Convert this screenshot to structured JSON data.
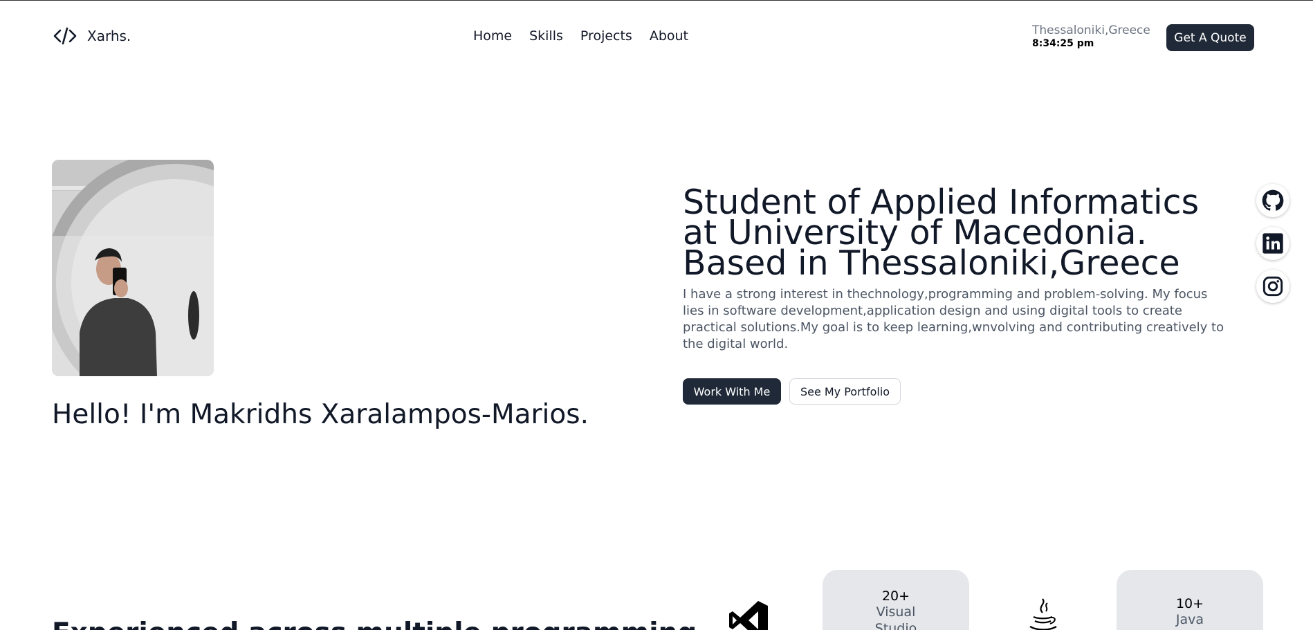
{
  "brand": {
    "name": "Xarhs.",
    "icon": "code-icon"
  },
  "nav": {
    "items": [
      "Home",
      "Skills",
      "Projects",
      "About"
    ]
  },
  "location": {
    "city": "Thessaloniki,Greece",
    "time": "8:34:25 pm"
  },
  "header": {
    "quote_label": "Get A Quote"
  },
  "hero": {
    "greeting": "Hello! I'm Makridhs Xaralampos-Marios.",
    "headline": "Student of Applied Informatics at University of Macedonia. Based in Thessaloniki,Greece",
    "description": "I have a strong interest in thechnology,programming and problem-solving. My focus lies in software development,application design and using digital tools to create practical solutions.My goal is to keep learning,wnvolving and contributing creatively to the digital world.",
    "primary_label": "Work With Me",
    "secondary_label": "See My Portfolio"
  },
  "social": [
    {
      "icon": "github-icon"
    },
    {
      "icon": "linkedin-icon"
    },
    {
      "icon": "instagram-icon"
    }
  ],
  "experience": {
    "title": "Experienced across multiple programming",
    "stats": [
      {
        "icon": "visual-studio-icon",
        "number": "20+",
        "label_lines": [
          "Visual",
          "Studio"
        ]
      },
      {
        "icon": "java-icon",
        "number": "10+",
        "label_lines": [
          "Java"
        ]
      }
    ]
  },
  "colors": {
    "dark": "#1f2937",
    "muted": "#4b5563",
    "card": "#e5e7eb"
  }
}
